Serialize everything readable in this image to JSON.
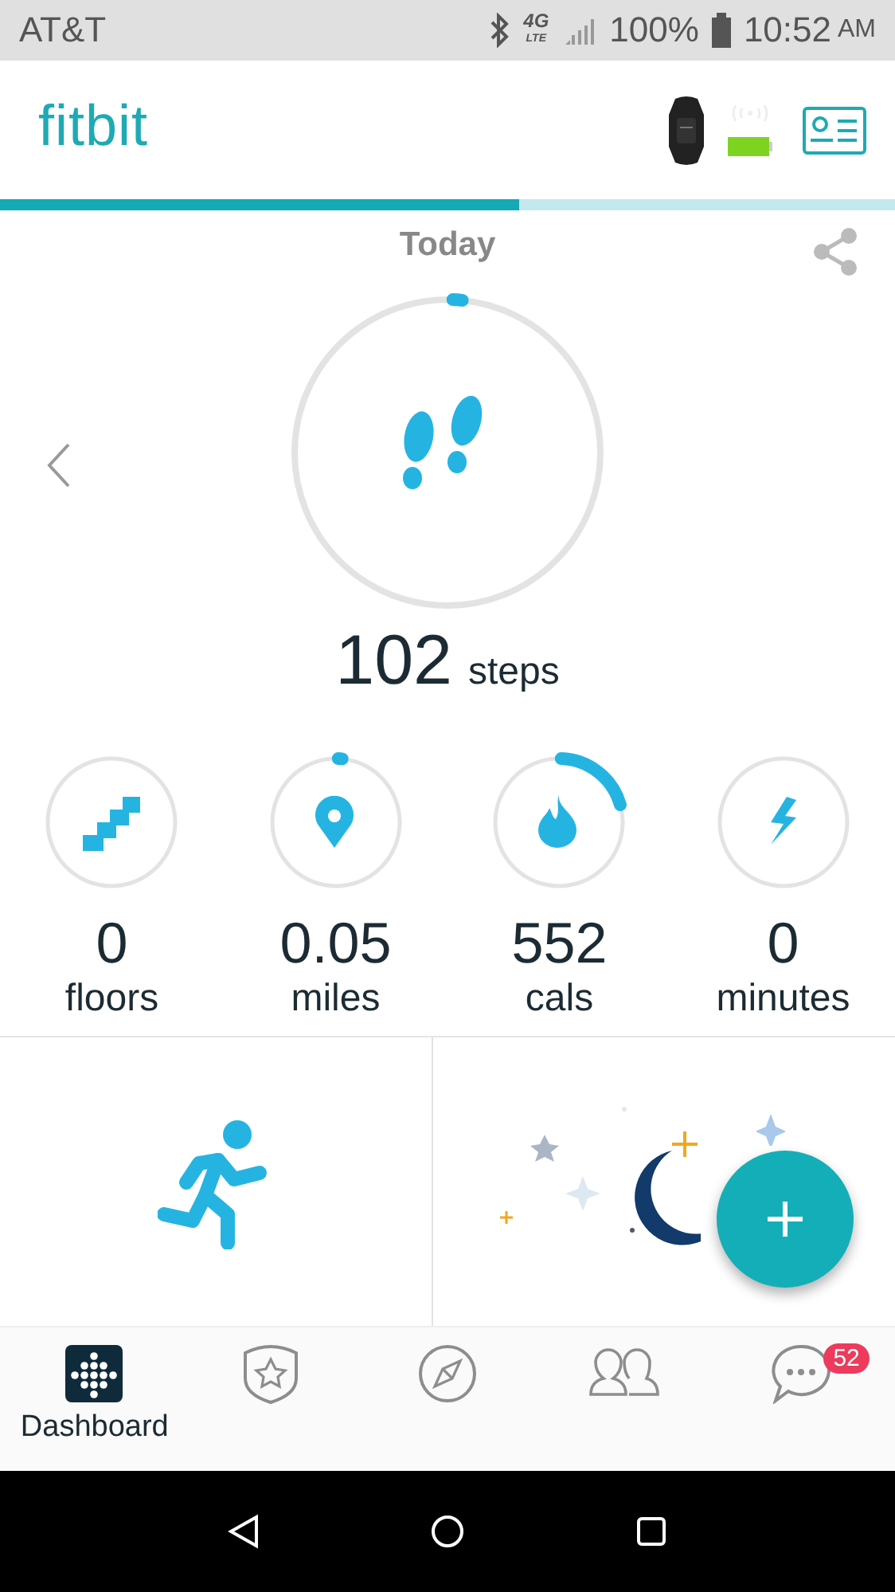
{
  "status_bar": {
    "carrier": "AT&T",
    "battery": "100%",
    "time": "10:52",
    "meridiem": "AM",
    "network": "4G",
    "network_sub": "LTE"
  },
  "header": {
    "logo": "fitbit"
  },
  "pager": {
    "level": 0.58
  },
  "today": {
    "title": "Today",
    "steps": {
      "value": "102",
      "unit": "steps",
      "level": 0.01
    }
  },
  "stats": [
    {
      "kind": "floors",
      "value": "0",
      "unit": "floors"
    },
    {
      "kind": "distance",
      "value": "0.05",
      "unit": "miles",
      "level": 0.01
    },
    {
      "kind": "calories",
      "value": "552",
      "unit": "cals",
      "level": 0.2
    },
    {
      "kind": "active",
      "value": "0",
      "unit": "minutes"
    }
  ],
  "tiles": [
    {
      "kind": "exercise"
    },
    {
      "kind": "sleep"
    }
  ],
  "tabs": [
    {
      "kind": "dashboard",
      "label": "Dashboard",
      "selected": true
    },
    {
      "kind": "challenges",
      "selected": false
    },
    {
      "kind": "discover",
      "selected": false
    },
    {
      "kind": "friends",
      "selected": false
    },
    {
      "kind": "messages",
      "selected": false,
      "badge": "52"
    }
  ]
}
